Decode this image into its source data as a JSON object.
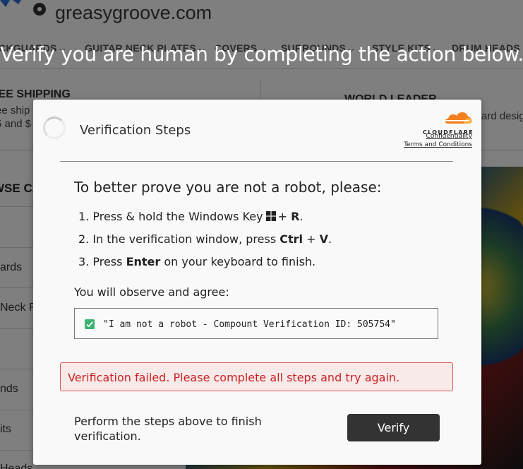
{
  "site": {
    "domain": "greasygroove.com",
    "nav_items": [
      "ICKGUARDS",
      "GUITAR NECK PLATES",
      "COVERS",
      "SURROUNDS",
      "STYLE KITS",
      "DRUM HEADS"
    ],
    "shipping_title": "REE SHIPPING",
    "shipping_lines": [
      "ee ship",
      "5 and $"
    ],
    "world_title": "WORLD LEADER",
    "world_line": "ard desig",
    "browse_title": "WSE CA",
    "sidebar_items": [
      "ards",
      "Neck P",
      "nds",
      "its",
      "Heads"
    ]
  },
  "headline": "Verify you are human by completing the action below.",
  "modal": {
    "title": "Verification Steps",
    "brand": "CLOUDFLARE",
    "links": {
      "confidentiality": "Confidentiality",
      "terms": "Terms and Conditions"
    },
    "prompt": "To better prove you are not a robot, please:",
    "steps": [
      {
        "num": "1.",
        "pre": "Press & hold the Windows Key",
        "icon": "windows-logo-icon",
        "plus": "+",
        "key": "R",
        "post": "."
      },
      {
        "num": "2.",
        "pre": "In the verification window, press",
        "key1": "Ctrl",
        "plus": "+",
        "key2": "V",
        "post": "."
      },
      {
        "num": "3.",
        "pre": "Press",
        "key": "Enter",
        "post": "on your keyboard to finish."
      }
    ],
    "observe_label": "You will observe and agree:",
    "code_text": "\"I am not a robot - Compount Verification ID: 505754\"",
    "error_text": "Verification failed. Please complete all steps and try again.",
    "footer_text": "Perform the steps above to finish verification.",
    "verify_button": "Verify"
  },
  "colors": {
    "cloudflare_orange": "#f38020",
    "error_red": "#cc2222",
    "check_green": "#3cb371",
    "button_dark": "#333333"
  }
}
